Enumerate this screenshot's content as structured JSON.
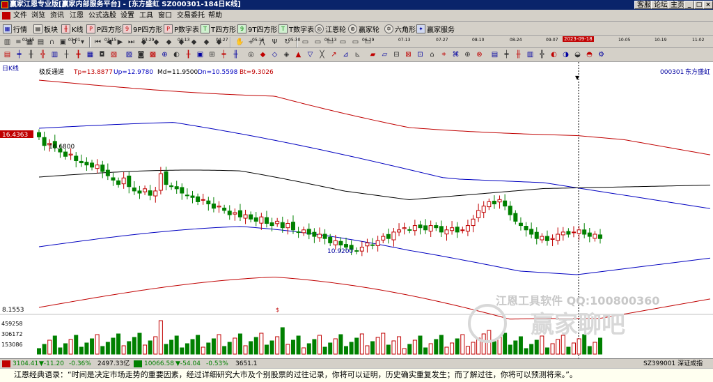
{
  "window": {
    "title": "赢家江恩专业版[赢家内部服务平台] - [东方盛虹   SZ000301-184日K线]",
    "buttons": [
      "客服",
      "论坛",
      "主页"
    ]
  },
  "menu": [
    "文件",
    "浏览",
    "资讯",
    "江恩",
    "公式选股",
    "设置",
    "工具",
    "窗口",
    "交易委托",
    "帮助"
  ],
  "toolbar1": [
    {
      "label": "行情",
      "icon": "quote-icon"
    },
    {
      "label": "板块",
      "icon": "sector-icon"
    },
    {
      "label": "K线",
      "icon": "kline-icon"
    },
    {
      "label": "P四方形",
      "icon": "p-square-icon"
    },
    {
      "label": "9P四方形",
      "icon": "9p-square-icon"
    },
    {
      "label": "P数字表",
      "icon": "p-number-table-icon"
    },
    {
      "label": "T四方形",
      "icon": "t-square-icon"
    },
    {
      "label": "9T四方形",
      "icon": "9t-square-icon"
    },
    {
      "label": "T数字表",
      "icon": "t-number-table-icon"
    },
    {
      "label": "江恩轮",
      "icon": "gann-wheel-icon"
    },
    {
      "label": "赢家轮",
      "icon": "winner-wheel-icon"
    },
    {
      "label": "六角形",
      "icon": "hexagon-icon"
    },
    {
      "label": "赢家服务",
      "icon": "winner-service-icon"
    }
  ],
  "toolbar2": {
    "small": [
      "∩",
      "▦",
      "0",
      "◀",
      "▶",
      "⏮",
      "⏭"
    ]
  },
  "timeline": {
    "dates": [
      "02-15",
      "03-01",
      "03-15",
      "03-29",
      "04-13",
      "04-27",
      "05-16",
      "05-30",
      "06-13",
      "06-29",
      "07-13",
      "07-27",
      "08-10",
      "08-24",
      "09-07",
      "10-05",
      "10-19",
      "11-02"
    ],
    "selected": "2023-09-18"
  },
  "chart_header": {
    "period": "日K线",
    "indicator": "极反通道",
    "tp": "Tp=13.8877",
    "up": "Up=12.9780",
    "md": "Md=11.9500",
    "dn": "Dn=10.5598",
    "bt": "Bt=9.3026",
    "stock_code": "000301",
    "stock_name": "东方盛虹"
  },
  "price_axis": {
    "top_label": "16.4363",
    "bottom_label": "8.1553",
    "high_marker": "16.6800",
    "low_marker": "10.9200"
  },
  "volume_axis": [
    "459258",
    "306172",
    "153086"
  ],
  "watermark": {
    "line1": "江恩工具软件  QQ:100800360",
    "line2": "赢家聊吧"
  },
  "statusbar": {
    "sh_index": "3104.41",
    "sh_change": "▼-11.20",
    "sh_pct": "-0.36%",
    "sh_amount": "2497.33亿",
    "sz_index": "10066.58",
    "sz_change": "▼-54.04",
    "sz_pct": "-0.53%",
    "sz_amount": "3651.1",
    "right_text": "SZ399001 深证成指"
  },
  "quote": "江恩经典语录：“时间是决定市场走势的重要因素，经过详细研究大市及个别股票的过往记录，你将可以证明，历史确实重复发生；而了解过往，你将可以预测将来。”。",
  "chart_data": {
    "type": "candlestick",
    "title": "东方盛虹 000301 日K线",
    "ylim": [
      8.1553,
      16.4363
    ],
    "closes": [
      16.2,
      15.8,
      15.9,
      15.7,
      15.5,
      15.3,
      15.4,
      15.1,
      15.0,
      14.9,
      14.8,
      14.9,
      14.6,
      14.4,
      14.2,
      14.0,
      14.3,
      13.9,
      13.7,
      13.6,
      13.8,
      13.5,
      13.7,
      14.5,
      14.0,
      13.9,
      13.8,
      13.6,
      13.5,
      13.4,
      13.2,
      13.3,
      13.1,
      12.9,
      13.0,
      12.8,
      12.6,
      12.7,
      12.5,
      12.6,
      12.4,
      12.3,
      12.5,
      12.2,
      12.1,
      12.3,
      12.0,
      12.2,
      11.9,
      11.8,
      11.9,
      11.7,
      11.6,
      11.7,
      11.5,
      11.3,
      11.4,
      11.2,
      11.1,
      11.0,
      10.92,
      11.1,
      11.3,
      11.2,
      11.4,
      11.6,
      11.5,
      11.8,
      11.9,
      12.0,
      11.9,
      12.1,
      12.0,
      11.9,
      12.1,
      12.0,
      11.8,
      11.9,
      12.0,
      11.8,
      11.9,
      12.1,
      12.4,
      12.8,
      13.0,
      13.2,
      13.1,
      13.3,
      13.0,
      12.6,
      12.3,
      12.1,
      11.9,
      11.7,
      11.5,
      11.6,
      11.4,
      11.5,
      11.7,
      11.8,
      11.7,
      11.8,
      11.9,
      11.7,
      11.6,
      11.7,
      11.5
    ]
  },
  "colors": {
    "up": "#c00000",
    "down": "#008000",
    "band_outer": "#c00000",
    "band_inner": "#0000c0",
    "middle": "#000000"
  }
}
